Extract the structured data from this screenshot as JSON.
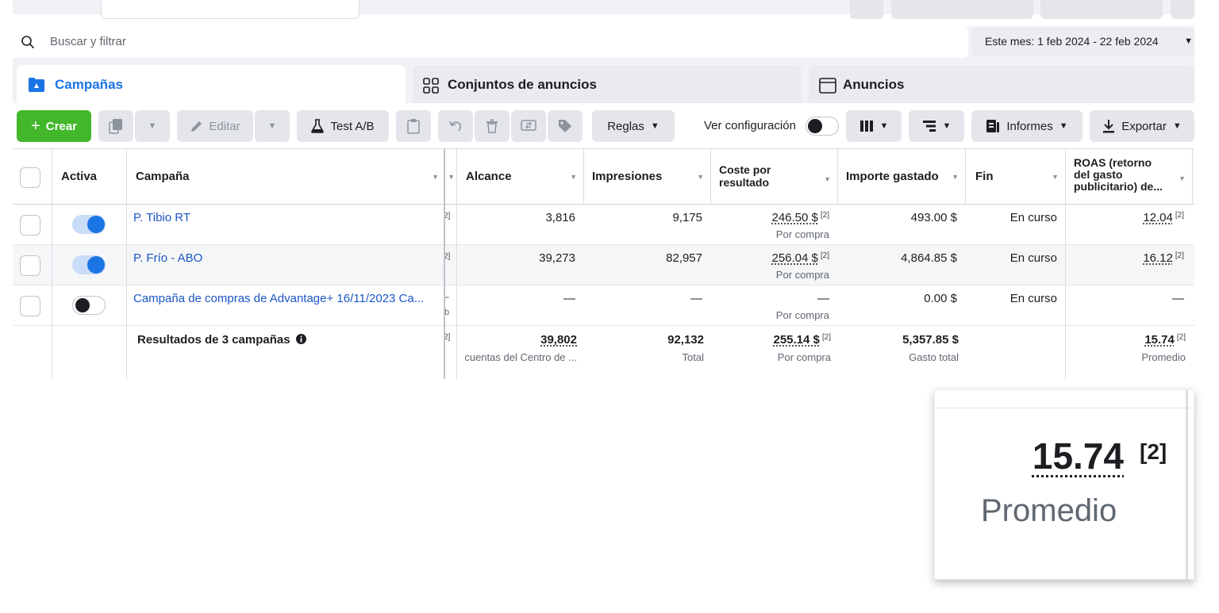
{
  "search": {
    "placeholder": "Buscar y filtrar"
  },
  "date_range": {
    "label": "Este mes: 1 feb 2024 - 22 feb 2024"
  },
  "tabs": [
    {
      "label": "Campañas",
      "active": true
    },
    {
      "label": "Conjuntos de anuncios",
      "active": false
    },
    {
      "label": "Anuncios",
      "active": false
    }
  ],
  "toolbar": {
    "create_label": "Crear",
    "edit_label": "Editar",
    "ab_test_label": "Test A/B",
    "rules_label": "Reglas",
    "view_setup_label": "Ver configuración",
    "reports_label": "Informes",
    "export_label": "Exportar"
  },
  "table": {
    "headers": {
      "active": "Activa",
      "campaign": "Campaña",
      "reach": "Alcance",
      "impressions": "Impresiones",
      "cost_per_result": "Coste por resultado",
      "amount_spent": "Importe gastado",
      "end": "Fin",
      "roas": "ROAS (retorno del gasto publicitario) de..."
    },
    "rows": [
      {
        "active": true,
        "campaign": "P. Tibio RT",
        "partial": "2]",
        "reach": "3,816",
        "impressions": "9,175",
        "cost": "246.50 $",
        "cost_sup": "[2]",
        "cost_sub": "Por compra",
        "spent": "493.00 $",
        "end": "En curso",
        "roas": "12.04",
        "roas_sup": "[2]"
      },
      {
        "active": true,
        "campaign": "P. Frío - ABO",
        "partial": "2]",
        "reach": "39,273",
        "impressions": "82,957",
        "cost": "256.04 $",
        "cost_sup": "[2]",
        "cost_sub": "Por compra",
        "spent": "4,864.85 $",
        "end": "En curso",
        "roas": "16.12",
        "roas_sup": "[2]"
      },
      {
        "active": false,
        "campaign": "Campaña de compras de Advantage+ 16/11/2023 Ca...",
        "partial": "–",
        "partial_sub": "b",
        "reach": "—",
        "impressions": "—",
        "cost": "—",
        "cost_sub": "Por compra",
        "spent": "0.00 $",
        "end": "En curso",
        "roas": "—"
      }
    ],
    "summary": {
      "label": "Resultados de 3 campañas",
      "partial": "2]",
      "reach": "39,802",
      "reach_sub": "cuentas del Centro de ...",
      "impressions": "92,132",
      "impressions_sub": "Total",
      "cost": "255.14 $",
      "cost_sup": "[2]",
      "cost_sub": "Por compra",
      "spent": "5,357.85 $",
      "spent_sub": "Gasto total",
      "roas": "15.74",
      "roas_sup": "[2]",
      "roas_sub": "Promedio"
    }
  },
  "zoom": {
    "value": "15.74",
    "sup": "[2]",
    "sub": "Promedio"
  },
  "colors": {
    "accent": "#1b74e4",
    "create": "#42b72a",
    "link": "#1b56c6"
  }
}
